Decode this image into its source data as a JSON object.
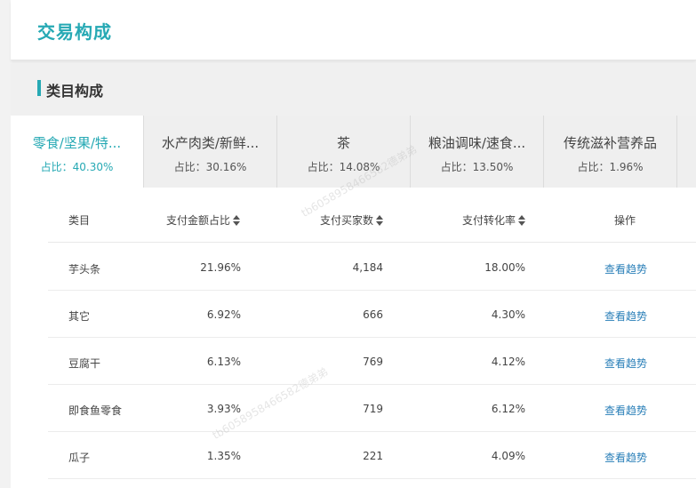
{
  "header": {
    "title": "交易构成"
  },
  "section": {
    "title": "类目构成"
  },
  "tabs": [
    {
      "name": "零食/坚果/特...",
      "ratio": "占比：40.30%",
      "active": true
    },
    {
      "name": "水产肉类/新鲜...",
      "ratio": "占比：30.16%",
      "active": false
    },
    {
      "name": "茶",
      "ratio": "占比：14.08%",
      "active": false
    },
    {
      "name": "粮油调味/速食...",
      "ratio": "占比：13.50%",
      "active": false
    },
    {
      "name": "传统滋补营养品",
      "ratio": "占比：1.96%",
      "active": false
    }
  ],
  "table": {
    "headers": {
      "category": "类目",
      "pay_amount_ratio": "支付金额占比",
      "buyers": "支付买家数",
      "conversion": "支付转化率",
      "action": "操作"
    },
    "rows": [
      {
        "category": "芋头条",
        "pay_amount_ratio": "21.96%",
        "buyers": "4,184",
        "conversion": "18.00%",
        "action": "查看趋势"
      },
      {
        "category": "其它",
        "pay_amount_ratio": "6.92%",
        "buyers": "666",
        "conversion": "4.30%",
        "action": "查看趋势"
      },
      {
        "category": "豆腐干",
        "pay_amount_ratio": "6.13%",
        "buyers": "769",
        "conversion": "4.12%",
        "action": "查看趋势"
      },
      {
        "category": "即食鱼零食",
        "pay_amount_ratio": "3.93%",
        "buyers": "719",
        "conversion": "6.12%",
        "action": "查看趋势"
      },
      {
        "category": "瓜子",
        "pay_amount_ratio": "1.35%",
        "buyers": "221",
        "conversion": "4.09%",
        "action": "查看趋势"
      }
    ]
  },
  "colors": {
    "accent": "#26a9b4",
    "link": "#2a7fb8"
  },
  "watermark": "tb6058958466582德弟弟"
}
